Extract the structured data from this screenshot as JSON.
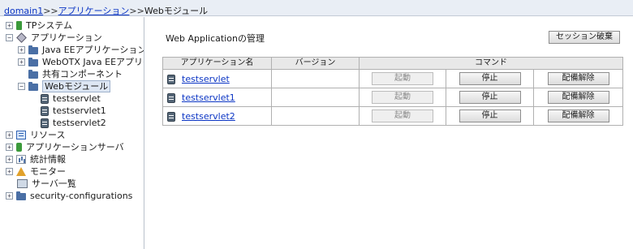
{
  "breadcrumb": {
    "root": "domain1",
    "sep1": ">>",
    "middle": "アプリケーション",
    "sep2": ">>",
    "current": "Webモジュール"
  },
  "tree": {
    "items": [
      {
        "label": "TPシステム",
        "icon": "book-icon",
        "toggle": "+"
      },
      {
        "label": "アプリケーション",
        "icon": "diamond-icon",
        "toggle": "−"
      },
      {
        "label": "Java EEアプリケーション",
        "icon": "folder-icon",
        "toggle": "+"
      },
      {
        "label": "WebOTX Java EEアプリケーション",
        "icon": "folder-icon",
        "toggle": "+"
      },
      {
        "label": "共有コンポーネント",
        "icon": "folder-icon",
        "toggle": ""
      },
      {
        "label": "Webモジュール",
        "icon": "folder-icon",
        "toggle": "−"
      },
      {
        "label": "testservlet",
        "icon": "jar-icon",
        "toggle": ""
      },
      {
        "label": "testservlet1",
        "icon": "jar-icon",
        "toggle": ""
      },
      {
        "label": "testservlet2",
        "icon": "jar-icon",
        "toggle": ""
      },
      {
        "label": "リソース",
        "icon": "list-icon",
        "toggle": "+"
      },
      {
        "label": "アプリケーションサーバ",
        "icon": "server-icon",
        "toggle": "+"
      },
      {
        "label": "統計情報",
        "icon": "stats-icon",
        "toggle": "+"
      },
      {
        "label": "モニター",
        "icon": "warning-icon",
        "toggle": "+"
      },
      {
        "label": "サーバ一覧",
        "icon": "monitor-icon",
        "toggle": ""
      },
      {
        "label": "security-configurations",
        "icon": "folder-icon",
        "toggle": "+"
      }
    ]
  },
  "main": {
    "title": "Web Applicationの管理",
    "session_button": "セッション破棄",
    "columns": {
      "name": "アプリケーション名",
      "version": "バージョン",
      "command": "コマンド"
    },
    "rows": [
      {
        "name": "testservlet",
        "version": "",
        "start": "起動",
        "stop": "停止",
        "undeploy": "配備解除"
      },
      {
        "name": "testservlet1",
        "version": "",
        "start": "起動",
        "stop": "停止",
        "undeploy": "配備解除"
      },
      {
        "name": "testservlet2",
        "version": "",
        "start": "起動",
        "stop": "停止",
        "undeploy": "配備解除"
      }
    ]
  },
  "colors": {
    "link": "#0b35c4",
    "header_bg": "#e8e8e8",
    "breadcrumb_bg": "#e9eef5"
  }
}
